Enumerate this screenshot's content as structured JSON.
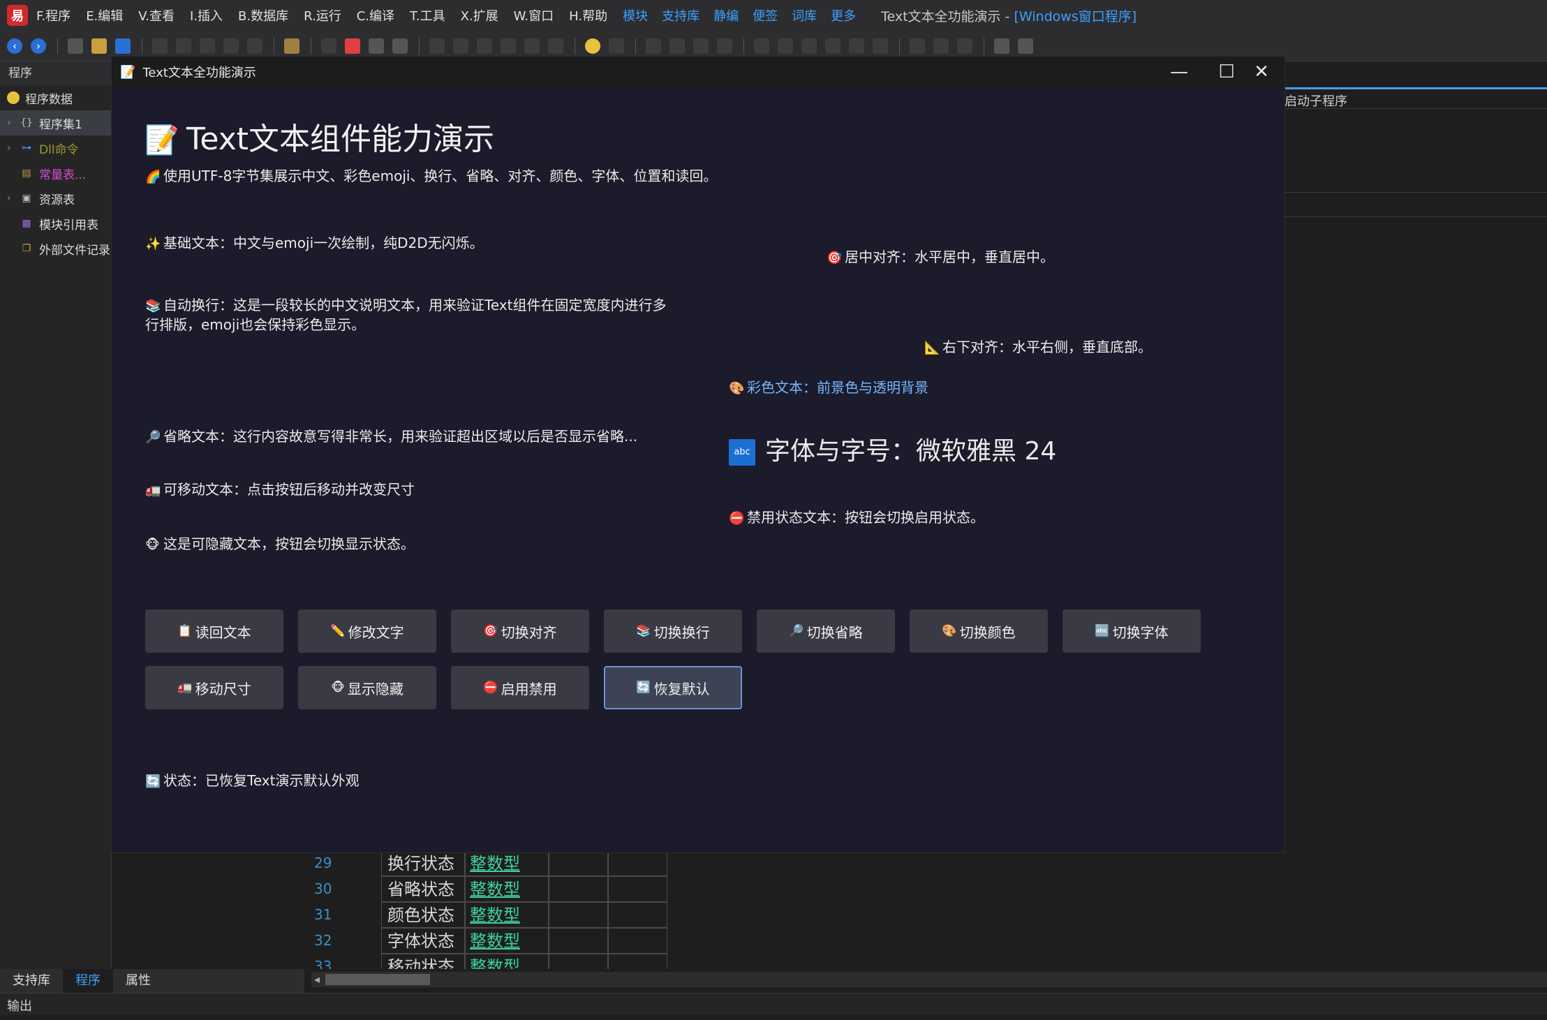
{
  "ide": {
    "logo": "易",
    "menu": [
      "F.程序",
      "E.编辑",
      "V.查看",
      "I.插入",
      "B.数据库",
      "R.运行",
      "C.编译",
      "T.工具",
      "X.扩展",
      "W.窗口",
      "H.帮助"
    ],
    "links": [
      "模块",
      "支持库",
      "静编",
      "便签",
      "词库",
      "更多"
    ],
    "title_main": "Text文本全功能演示 - ",
    "title_suffix": "[Windows窗口程序]",
    "left_panel": {
      "header": "程序",
      "items": [
        {
          "label": "程序数据",
          "color": "#e0e0e0",
          "icon": "smiley-icon"
        },
        {
          "label": "程序集1",
          "color": "#e0e0e0",
          "icon": "braces-icon"
        },
        {
          "label": "Dll命令",
          "color": "#9c9c2a",
          "icon": "dll-icon"
        },
        {
          "label": "常量表...",
          "color": "#d050d0",
          "icon": "constant-icon"
        },
        {
          "label": "资源表",
          "color": "#e0e0e0",
          "icon": "resource-icon"
        },
        {
          "label": "模块引用表",
          "color": "#e0e0e0",
          "icon": "module-icon"
        },
        {
          "label": "外部文件记录",
          "color": "#e0e0e0",
          "icon": "external-file-icon"
        }
      ]
    },
    "right_tab": "启动子程序",
    "code_rows": [
      {
        "num": "29",
        "name": "换行状态",
        "type": "整数型"
      },
      {
        "num": "30",
        "name": "省略状态",
        "type": "整数型"
      },
      {
        "num": "31",
        "name": "颜色状态",
        "type": "整数型"
      },
      {
        "num": "32",
        "name": "字体状态",
        "type": "整数型"
      },
      {
        "num": "33",
        "name": "移动状态",
        "type": "整数型"
      }
    ],
    "bottom_tabs": [
      "支持库",
      "程序",
      "属性"
    ],
    "output_label": "输出"
  },
  "window": {
    "title": "Text文本全功能演示",
    "icon": "📝",
    "minimize": "—",
    "maximize": "☐",
    "close": "✕"
  },
  "demo": {
    "heading_emoji": "📝",
    "heading": "Text文本组件能力演示",
    "subtitle_emoji": "🌈",
    "subtitle": "使用UTF-8字节集展示中文、彩色emoji、换行、省略、对齐、颜色、字体、位置和读回。",
    "basic_emoji": "✨",
    "basic": "基础文本：中文与emoji一次绘制，纯D2D无闪烁。",
    "center_emoji": "🎯",
    "center": "居中对齐：水平居中，垂直居中。",
    "wrap_emoji": "📚",
    "wrap": "自动换行：这是一段较长的中文说明文本，用来验证Text组件在固定宽度内进行多行排版，emoji也会保持彩色显示。",
    "bottom_right_emoji": "📐",
    "bottom_right": "右下对齐：水平右侧，垂直底部。",
    "color_emoji": "🎨",
    "color_text": "彩色文本：前景色与透明背景",
    "ellipsis_emoji": "🔎",
    "ellipsis": "省略文本：这行内容故意写得非常长，用来验证超出区域以后是否显示省略...",
    "font_badge": "abc",
    "font_text": "字体与字号：微软雅黑 24",
    "movable_emoji": "🚛",
    "movable": "可移动文本：点击按钮后移动并改变尺寸",
    "disabled_emoji": "⛔",
    "disabled": "禁用状态文本：按钮会切换启用状态。",
    "hidden_emoji": "🐵",
    "hidden": "这是可隐藏文本，按钮会切换显示状态。",
    "status_emoji": "🔄",
    "status": "状态：已恢复Text演示默认外观",
    "text_color": "#ebebeb",
    "color_text_color": "#76b7ff",
    "background": "#1b1b2b"
  },
  "buttons": {
    "read_back": {
      "icon": "📋",
      "label": "读回文本"
    },
    "edit_text": {
      "icon": "✏️",
      "label": "修改文字"
    },
    "toggle_align": {
      "icon": "🎯",
      "label": "切换对齐"
    },
    "toggle_wrap": {
      "icon": "📚",
      "label": "切换换行"
    },
    "toggle_ellipsis": {
      "icon": "🔎",
      "label": "切换省略"
    },
    "toggle_color": {
      "icon": "🎨",
      "label": "切换颜色"
    },
    "toggle_font": {
      "icon": "🔤",
      "label": "切换字体"
    },
    "move_resize": {
      "icon": "🚛",
      "label": "移动尺寸"
    },
    "show_hide": {
      "icon": "🐵",
      "label": "显示隐藏"
    },
    "enable_disable": {
      "icon": "⛔",
      "label": "启用禁用"
    },
    "restore_default": {
      "icon": "🔄",
      "label": "恢复默认"
    }
  }
}
